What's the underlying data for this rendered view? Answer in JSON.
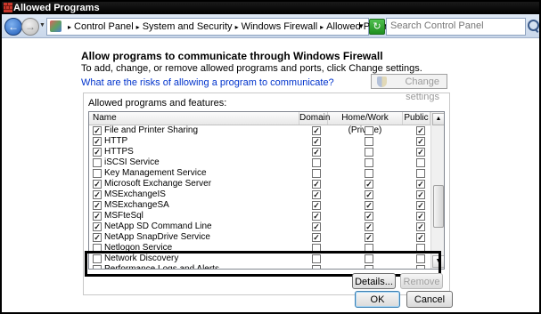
{
  "window": {
    "title": "Allowed Programs"
  },
  "address": {
    "breadcrumbs": [
      "Control Panel",
      "System and Security",
      "Windows Firewall",
      "Allowed Programs"
    ],
    "search_placeholder": "Search Control Panel"
  },
  "content": {
    "heading": "Allow programs to communicate through Windows Firewall",
    "description": "To add, change, or remove allowed programs and ports, click Change settings.",
    "risk_link": "What are the risks of allowing a program to communicate?",
    "change_settings_label": "Change settings",
    "group_label": "Allowed programs and features:"
  },
  "table": {
    "columns": [
      "Name",
      "Domain",
      "Home/Work (Private)",
      "Public"
    ],
    "rows": [
      {
        "name": "File and Printer Sharing",
        "enabled": true,
        "domain": true,
        "home": false,
        "public": true
      },
      {
        "name": "HTTP",
        "enabled": true,
        "domain": true,
        "home": false,
        "public": true
      },
      {
        "name": "HTTPS",
        "enabled": true,
        "domain": true,
        "home": false,
        "public": true
      },
      {
        "name": "iSCSI Service",
        "enabled": false,
        "domain": false,
        "home": false,
        "public": false
      },
      {
        "name": "Key Management Service",
        "enabled": false,
        "domain": false,
        "home": false,
        "public": false
      },
      {
        "name": "Microsoft Exchange Server",
        "enabled": true,
        "domain": true,
        "home": true,
        "public": true
      },
      {
        "name": "MSExchangeIS",
        "enabled": true,
        "domain": true,
        "home": true,
        "public": true
      },
      {
        "name": "MSExchangeSA",
        "enabled": true,
        "domain": true,
        "home": true,
        "public": true
      },
      {
        "name": "MSFteSql",
        "enabled": true,
        "domain": true,
        "home": true,
        "public": true
      },
      {
        "name": "NetApp SD Command Line",
        "enabled": true,
        "domain": true,
        "home": true,
        "public": true
      },
      {
        "name": "NetApp SnapDrive Service",
        "enabled": true,
        "domain": true,
        "home": true,
        "public": true
      },
      {
        "name": "Netlogon Service",
        "enabled": false,
        "domain": false,
        "home": false,
        "public": false
      },
      {
        "name": "Network Discovery",
        "enabled": false,
        "domain": false,
        "home": false,
        "public": false
      },
      {
        "name": "Performance Logs and Alerts",
        "enabled": false,
        "domain": false,
        "home": false,
        "public": false
      }
    ]
  },
  "buttons": {
    "details": "Details...",
    "remove": "Remove",
    "ok": "OK",
    "cancel": "Cancel"
  }
}
